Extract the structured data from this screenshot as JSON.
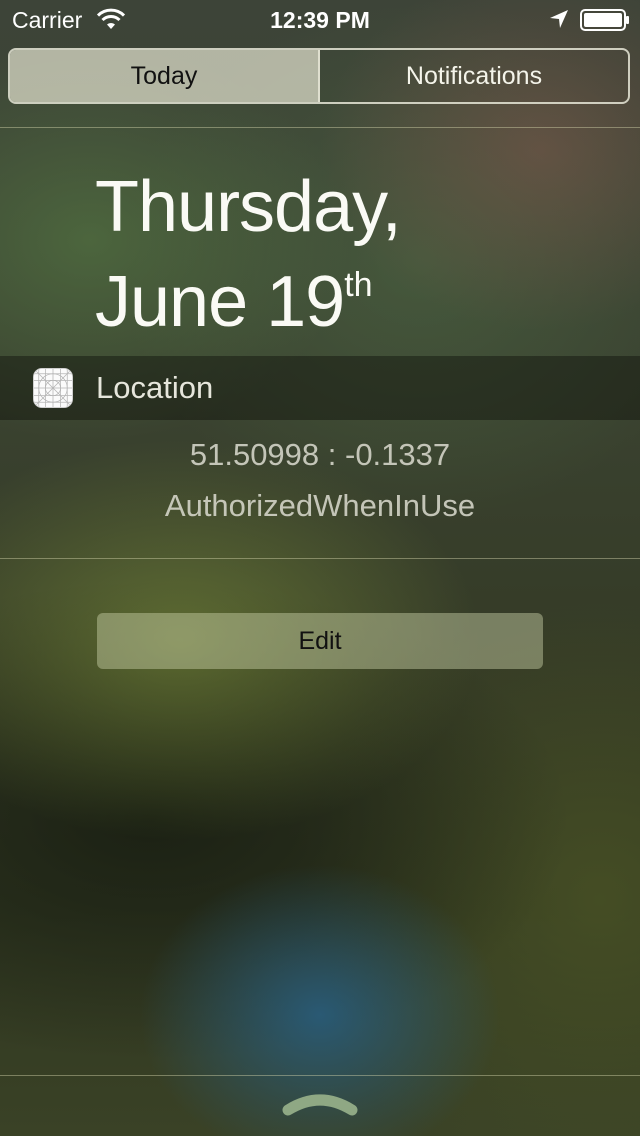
{
  "status_bar": {
    "carrier": "Carrier",
    "time": "12:39 PM",
    "icons": [
      "wifi-icon",
      "location-arrow-icon",
      "battery-icon"
    ]
  },
  "segmented_control": {
    "tabs": [
      {
        "label": "Today",
        "selected": true
      },
      {
        "label": "Notifications",
        "selected": false
      }
    ]
  },
  "date": {
    "line1": "Thursday,",
    "line2": "June 19",
    "ordinal_suffix": "th"
  },
  "widget": {
    "icon": "app-icon-grid",
    "title": "Location",
    "coordinates": "51.50998 : -0.1337",
    "authorization": "AuthorizedWhenInUse"
  },
  "edit_button": {
    "label": "Edit"
  },
  "bottom": {
    "icon": "grabber-handle-icon"
  },
  "colors": {
    "segment_selected_bg": "#e1e1cd",
    "divider": "#d2d2aa",
    "text_primary": "#ffffff"
  }
}
